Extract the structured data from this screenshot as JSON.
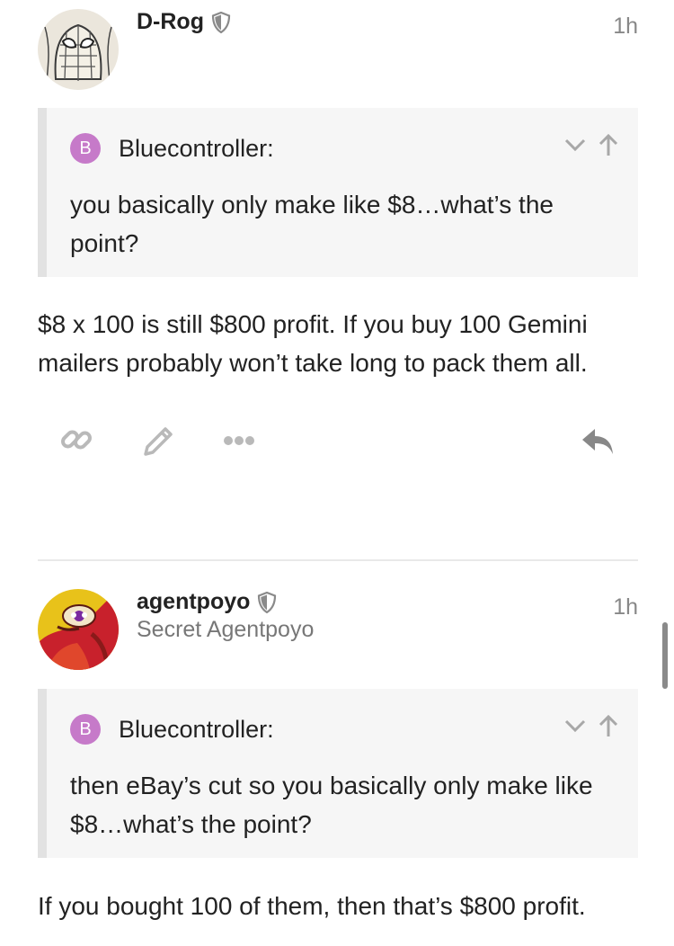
{
  "posts": [
    {
      "username": "D-Rog",
      "time": "1h",
      "quote": {
        "avatar_letter": "B",
        "author": "Bluecontroller:",
        "text": "you basically only make like $8…what’s the point?"
      },
      "body": "$8 x 100 is still $800 profit. If you buy 100 Gemini mailers probably won’t take long to pack them all.",
      "actions": {
        "link_icon": "link-icon",
        "edit_icon": "pencil-icon",
        "more_icon": "ellipsis-icon",
        "reply_icon": "reply-icon"
      }
    },
    {
      "username": "agentpoyo",
      "user_title": "Secret Agentpoyo",
      "time": "1h",
      "quote": {
        "avatar_letter": "B",
        "author": "Bluecontroller:",
        "text": "then eBay’s cut so you basically only make like $8…what’s the point?"
      },
      "body": "If you bought 100 of them, then that’s $800 profit."
    }
  ],
  "colors": {
    "quote_avatar": "#c67ac9",
    "quote_bg": "#f6f6f6",
    "quote_border": "#e2e2e2",
    "icon_gray": "#b9b9b9",
    "text": "#222222"
  }
}
